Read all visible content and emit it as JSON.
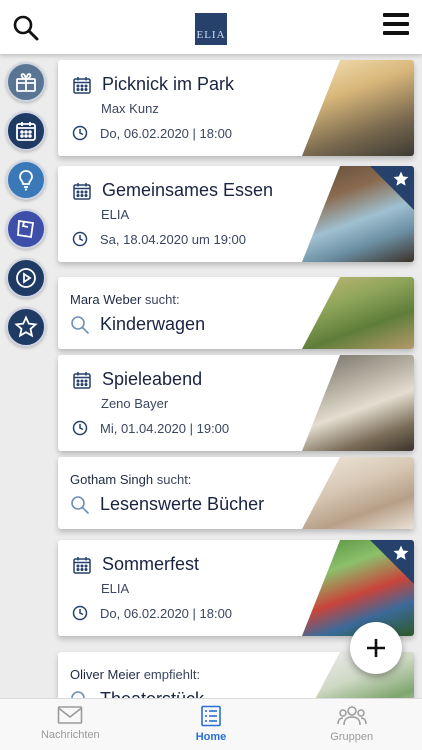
{
  "header": {
    "logo_text": "ELIA",
    "icons": {
      "search": "search-icon",
      "menu": "menu-icon"
    }
  },
  "sidebar": {
    "items": [
      {
        "icon": "gift-icon",
        "color": "#5a7593"
      },
      {
        "icon": "calendar-icon",
        "color": "#1f3a63"
      },
      {
        "icon": "lightbulb-icon",
        "color": "#3a78b8"
      },
      {
        "icon": "sticker-icon",
        "color": "#3d4fa8"
      },
      {
        "icon": "play-icon",
        "color": "#1f3a63"
      },
      {
        "icon": "star-icon",
        "color": "#1f3a63"
      }
    ]
  },
  "feed": {
    "cards": [
      {
        "type": "event",
        "title": "Picknick im Park",
        "organizer": "Max Kunz",
        "date": "Do, 06.02.2020 | 18:00",
        "starred": false
      },
      {
        "type": "event",
        "title": "Gemeinsames Essen",
        "organizer": "ELIA",
        "date": "Sa, 18.04.2020 um 19:00",
        "starred": true
      },
      {
        "type": "request",
        "person": "Mara Weber",
        "verb": "sucht:",
        "title": "Kinderwagen"
      },
      {
        "type": "event",
        "title": "Spieleabend",
        "organizer": "Zeno Bayer",
        "date": "Mi, 01.04.2020 | 19:00",
        "starred": false
      },
      {
        "type": "request",
        "person": "Gotham Singh",
        "verb": "sucht:",
        "title": "Lesenswerte Bücher"
      },
      {
        "type": "event",
        "title": "Sommerfest",
        "organizer": "ELIA",
        "date": "Do, 06.02.2020 | 18:00",
        "starred": true
      },
      {
        "type": "request",
        "person": "Oliver Meier",
        "verb": "empfiehlt:",
        "title": "Theaterstück"
      }
    ]
  },
  "fab": {
    "icon": "plus-icon"
  },
  "bottom_nav": {
    "items": [
      {
        "label": "Nachrichten",
        "icon": "mail-icon",
        "active": false
      },
      {
        "label": "Home",
        "icon": "list-icon",
        "active": true
      },
      {
        "label": "Gruppen",
        "icon": "group-icon",
        "active": false
      }
    ]
  },
  "colors": {
    "brand": "#26416b",
    "active": "#2a6fd6",
    "background": "#ececec"
  }
}
